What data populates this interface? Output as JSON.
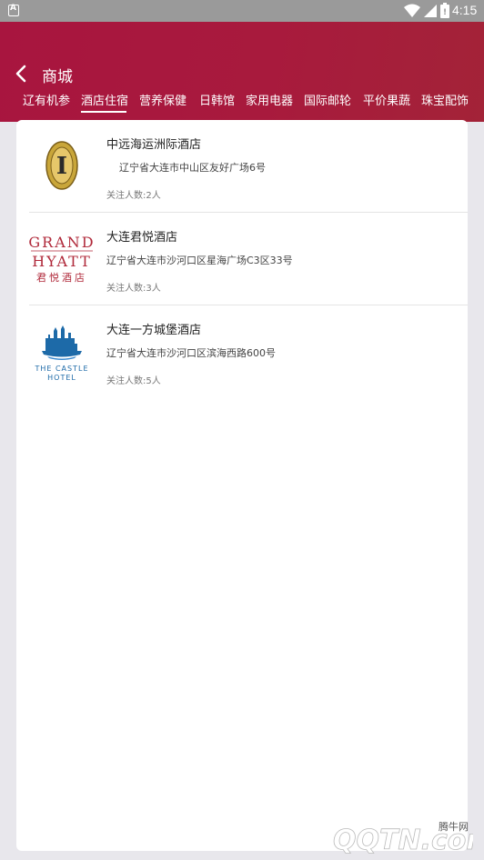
{
  "status_bar": {
    "time": "4:15"
  },
  "header": {
    "title": "商城",
    "tabs": [
      {
        "label": "辽有机参"
      },
      {
        "label": "酒店住宿"
      },
      {
        "label": "营养保健"
      },
      {
        "label": "日韩馆"
      },
      {
        "label": "家用电器"
      },
      {
        "label": "国际邮轮"
      },
      {
        "label": "平价果蔬"
      },
      {
        "label": "珠宝配饰"
      }
    ],
    "active_tab": "酒店住宿"
  },
  "hotels": [
    {
      "name": "中远海运洲际酒店",
      "address": "辽宁省大连市中山区友好广场6号",
      "followers": "关注人数:2人",
      "logo": "intercontinental-logo",
      "logo_letter": "I"
    },
    {
      "name": "大连君悦酒店",
      "address": "辽宁省大连市沙河口区星海广场C3区33号",
      "followers": "关注人数:3人",
      "logo": "grand-hyatt-logo",
      "logo_line1": "GRAND",
      "logo_line2": "HYATT",
      "logo_line3": "君悦酒店"
    },
    {
      "name": "大连一方城堡酒店",
      "address": "辽宁省大连市沙河口区滨海西路600号",
      "followers": "关注人数:5人",
      "logo": "castle-hotel-logo",
      "logo_line1": "THE CASTLE",
      "logo_line2": "HOTEL"
    }
  ],
  "watermark": {
    "text": "腾牛网",
    "brand": "QQTN.com"
  },
  "colors": {
    "header": "#a8153f",
    "background": "#e8e7ec",
    "hyatt_red": "#b0293a",
    "castle_blue": "#1d6aa8",
    "ic_gold": "#c9a63a"
  }
}
